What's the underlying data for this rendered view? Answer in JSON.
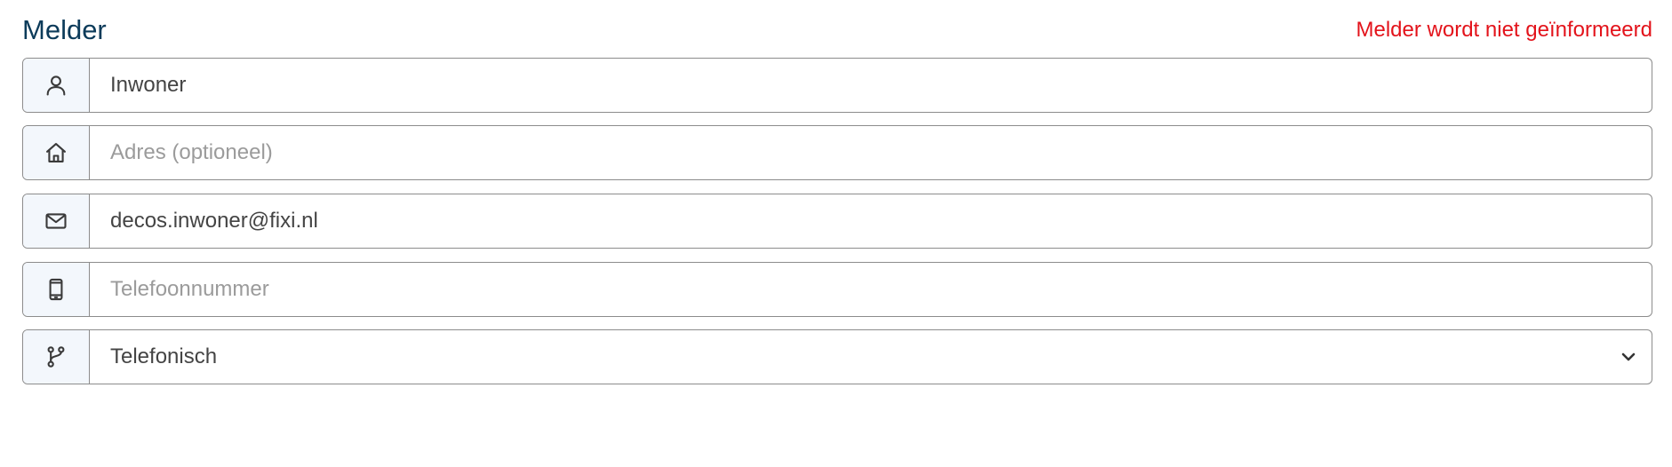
{
  "section": {
    "title": "Melder",
    "notice": "Melder wordt niet geïnformeerd"
  },
  "fields": {
    "name": {
      "icon": "person-icon",
      "value": "Inwoner",
      "placeholder": ""
    },
    "address": {
      "icon": "home-icon",
      "value": "",
      "placeholder": "Adres (optioneel)"
    },
    "email": {
      "icon": "envelope-icon",
      "value": "decos.inwoner@fixi.nl",
      "placeholder": ""
    },
    "phone": {
      "icon": "mobile-phone-icon",
      "value": "",
      "placeholder": "Telefoonnummer"
    },
    "channel": {
      "icon": "branch-icon",
      "selected": "Telefonisch"
    }
  },
  "colors": {
    "title": "#0c3b5a",
    "notice": "#e3131b",
    "addon_background": "#f3f7fc",
    "border": "#8c8c8c"
  }
}
